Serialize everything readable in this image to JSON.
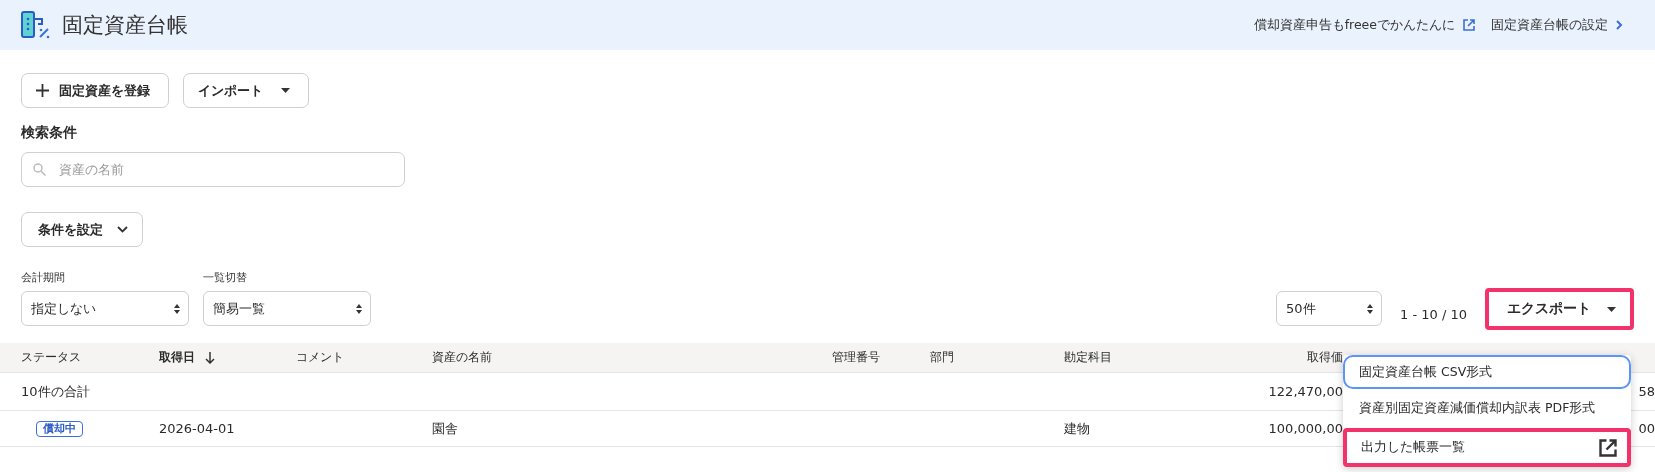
{
  "header": {
    "title": "固定資産台帳",
    "links": [
      {
        "label": "償却資産申告もfreeeでかんたんに",
        "kind": "external"
      },
      {
        "label": "固定資産台帳の設定",
        "kind": "settings"
      }
    ]
  },
  "actions": [
    {
      "label": "固定資産を登録",
      "kind": "add"
    },
    {
      "label": "インポート",
      "kind": "dropdown"
    }
  ],
  "search": {
    "heading": "検索条件",
    "placeholder": "資産の名前"
  },
  "conditions_button": {
    "label": "条件を設定"
  },
  "filters": [
    {
      "label": "会計期間",
      "value": "指定しない"
    },
    {
      "label": "一覧切替",
      "value": "簡易一覧"
    }
  ],
  "pagination": {
    "per_page": "50件",
    "range": "1 - 10 / 10"
  },
  "export_button": {
    "label": "エクスポート",
    "highlighted": true
  },
  "table": {
    "columns": [
      {
        "label": "ステータス",
        "sorted": false
      },
      {
        "label": "取得日",
        "sorted": true
      },
      {
        "label": "コメント",
        "sorted": false
      },
      {
        "label": "資産の名前",
        "sorted": false
      },
      {
        "label": "管理番号",
        "sorted": false
      },
      {
        "label": "部門",
        "sorted": false
      },
      {
        "label": "勘定科目",
        "sorted": false
      },
      {
        "label": "取得価",
        "sorted": false
      }
    ],
    "rows": [
      {
        "kind": "total",
        "label": "10件の合計",
        "column_8": "122,470,00",
        "column_9": "58"
      },
      {
        "kind": "asset",
        "status": "償却中",
        "acquired_on": "2026-04-01",
        "asset_name": "園舎",
        "account": "建物",
        "column_8": "100,000,00",
        "column_9": "00"
      }
    ]
  },
  "export_menu": {
    "items": [
      {
        "label": "固定資産台帳 CSV形式",
        "kind": "export",
        "focused": true,
        "highlighted": false
      },
      {
        "label": "資産別固定資産減価償却内訳表 PDF形式",
        "kind": "export",
        "focused": false,
        "highlighted": false
      },
      {
        "label": "出力した帳票一覧",
        "kind": "link",
        "focused": false,
        "highlighted": true
      }
    ]
  }
}
